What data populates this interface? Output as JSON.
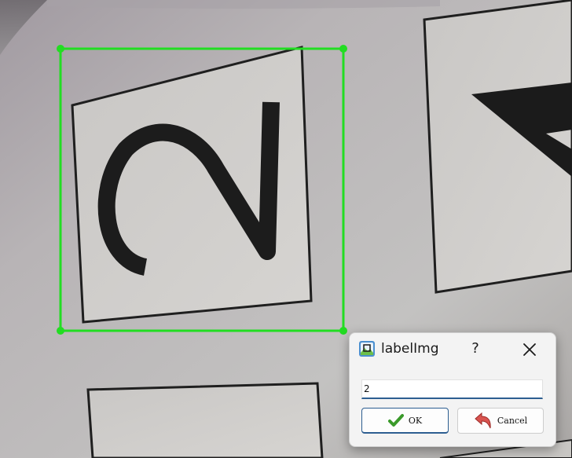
{
  "dialog": {
    "title": "labelImg",
    "help_label": "?",
    "input_value": "2",
    "ok_label": "OK",
    "cancel_label": "Cancel"
  },
  "annotation": {
    "box_color": "#22dd22",
    "label": "2"
  },
  "colors": {
    "accent": "#2d5e91",
    "ok_icon": "#3a9a2a",
    "cancel_icon": "#d9534f"
  },
  "icons": {
    "app": "labelimg-app-icon",
    "help": "help-icon",
    "close": "close-icon",
    "ok": "checkmark-icon",
    "cancel": "undo-arrow-icon"
  }
}
